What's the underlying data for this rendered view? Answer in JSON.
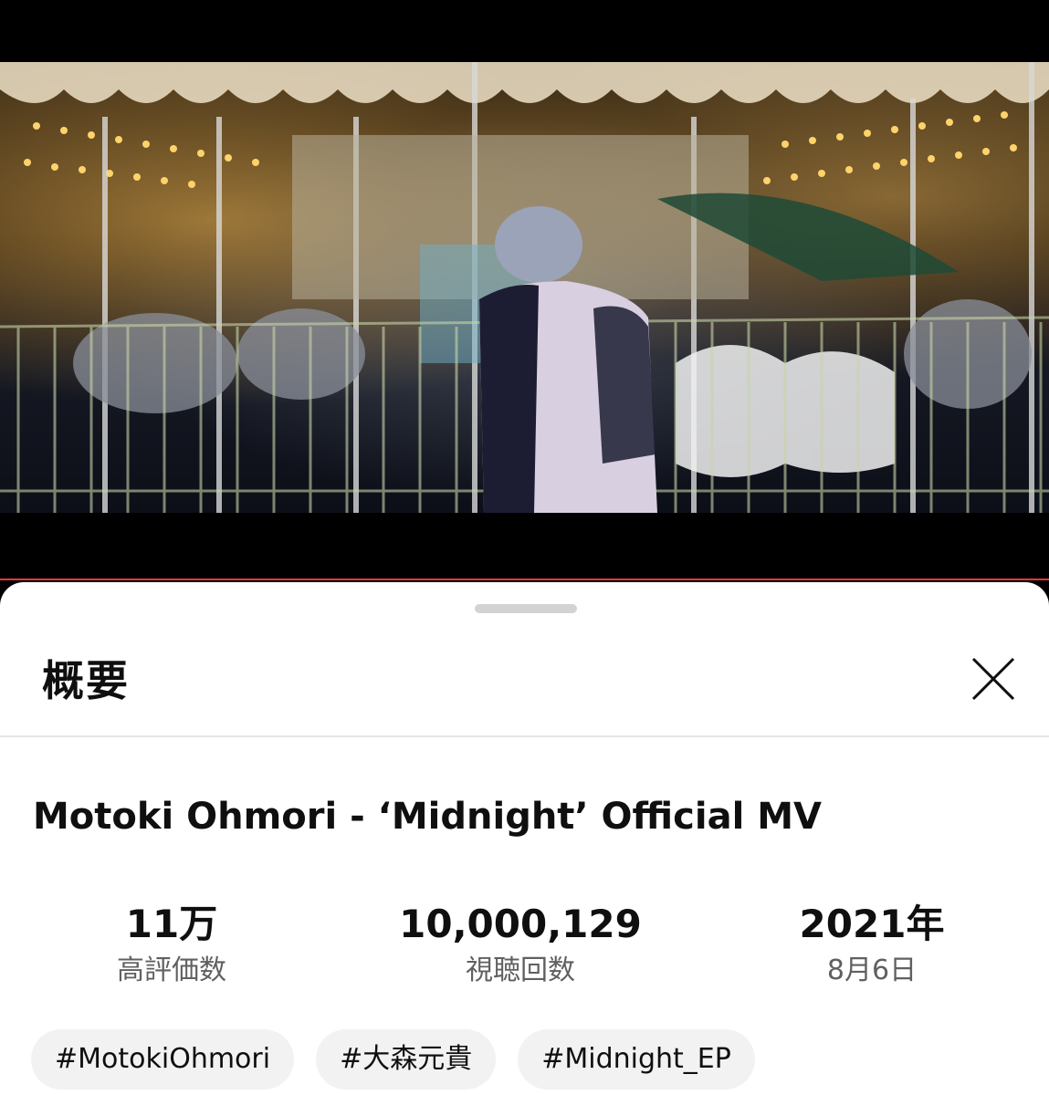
{
  "sheet": {
    "title": "概要",
    "close_icon": "close-icon"
  },
  "video": {
    "title": "Motoki Ohmori - ‘Midnight’ Official MV",
    "progress_color": "#e53935"
  },
  "stats": [
    {
      "value": "11万",
      "label": "高評価数"
    },
    {
      "value": "10,000,129",
      "label": "視聴回数"
    },
    {
      "value": "2021年",
      "label": "8月6日"
    }
  ],
  "tags": [
    "#MotokiOhmori",
    "#大森元貴",
    "#Midnight_EP"
  ]
}
